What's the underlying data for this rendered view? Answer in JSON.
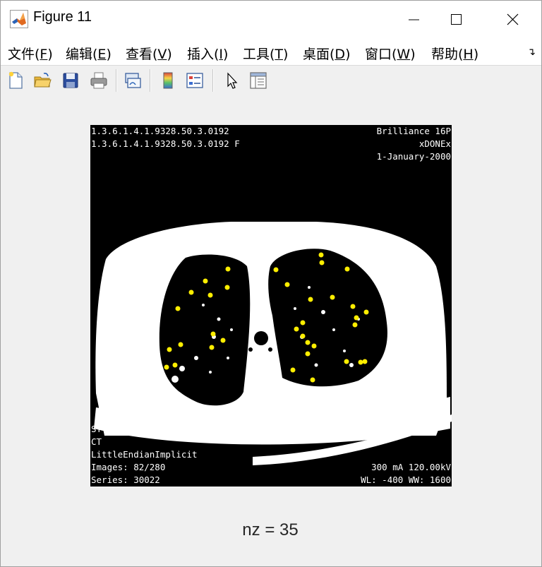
{
  "window": {
    "title": "Figure 11"
  },
  "menu": [
    {
      "label": "文件(",
      "acc": "F",
      "end": ")"
    },
    {
      "label": "编辑(",
      "acc": "E",
      "end": ")"
    },
    {
      "label": "查看(",
      "acc": "V",
      "end": ")"
    },
    {
      "label": "插入(",
      "acc": "I",
      "end": ")"
    },
    {
      "label": "工具(",
      "acc": "T",
      "end": ")"
    },
    {
      "label": "桌面(",
      "acc": "D",
      "end": ")"
    },
    {
      "label": "窗口(",
      "acc": "W",
      "end": ")"
    },
    {
      "label": "帮助(",
      "acc": "H",
      "end": ")"
    }
  ],
  "toolbar_icons": [
    "new-figure-icon",
    "open-file-icon",
    "save-icon",
    "print-icon",
    "link-plot-icon",
    "colorbar-icon",
    "legend-icon",
    "select-pointer-icon",
    "property-editor-icon"
  ],
  "ct_overlay": {
    "top_left": [
      "1.3.6.1.4.1.9328.50.3.0192",
      "1.3.6.1.4.1.9328.50.3.0192 F"
    ],
    "top_right": [
      "Brilliance 16P",
      "xDONEx",
      "1-January-2000"
    ],
    "bottom_left": [
      "ST: 2.00 SE",
      "CT",
      "LittleEndianImplicit",
      "Images: 82/280",
      "Series: 30022"
    ],
    "bottom_right": [
      "300 mA 120.00kV",
      "WL: -400 WW: 1600"
    ]
  },
  "xlabel": "nz = 35",
  "colors": {
    "marker": "#ffee00",
    "background": "#f0f0f0"
  },
  "chart_data": {
    "type": "scatter",
    "xlabel": "nz = 35",
    "marker_color": "#ffee00",
    "points": [
      [
        455,
        361
      ],
      [
        456,
        372
      ],
      [
        391,
        382
      ],
      [
        492,
        381
      ],
      [
        323,
        381
      ],
      [
        291,
        398
      ],
      [
        407,
        403
      ],
      [
        322,
        407
      ],
      [
        271,
        414
      ],
      [
        298,
        418
      ],
      [
        471,
        421
      ],
      [
        440,
        424
      ],
      [
        500,
        434
      ],
      [
        519,
        442
      ],
      [
        252,
        437
      ],
      [
        505,
        450
      ],
      [
        429,
        457
      ],
      [
        503,
        460
      ],
      [
        420,
        466
      ],
      [
        302,
        473
      ],
      [
        429,
        476
      ],
      [
        316,
        482
      ],
      [
        436,
        485
      ],
      [
        256,
        488
      ],
      [
        445,
        490
      ],
      [
        300,
        492
      ],
      [
        240,
        495
      ],
      [
        436,
        501
      ],
      [
        491,
        512
      ],
      [
        517,
        512
      ],
      [
        511,
        513
      ],
      [
        248,
        517
      ],
      [
        236,
        520
      ],
      [
        415,
        524
      ],
      [
        443,
        538
      ]
    ],
    "point_count": 35
  }
}
